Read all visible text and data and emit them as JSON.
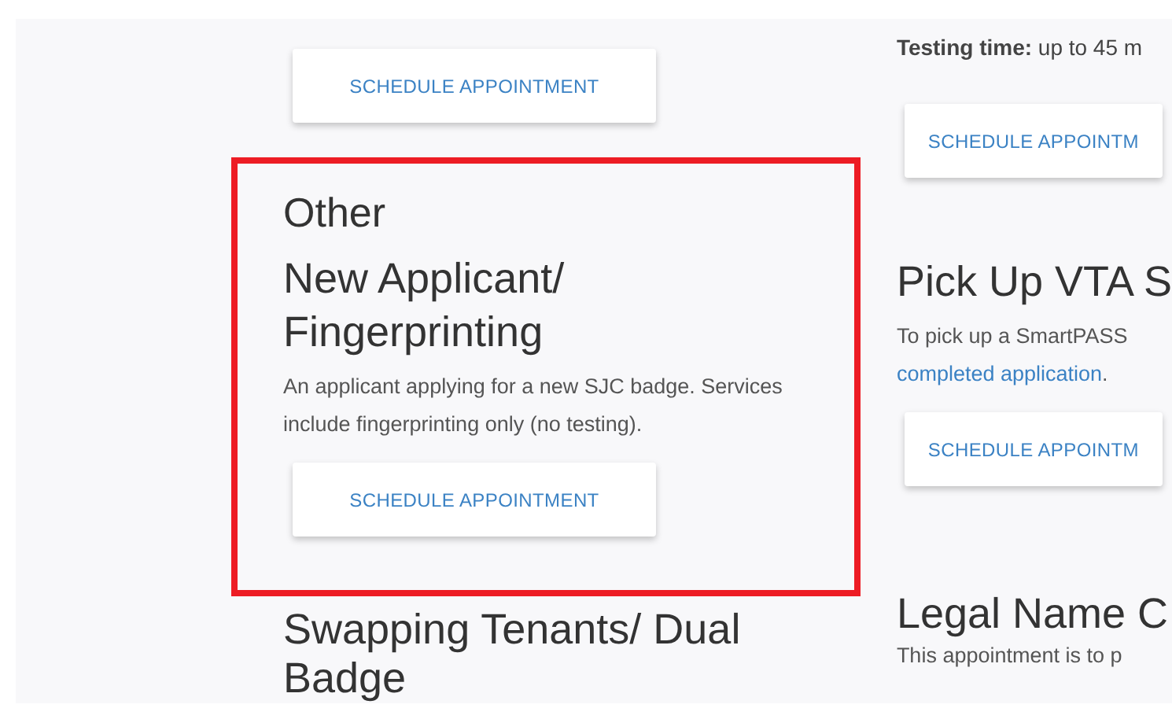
{
  "left_column": {
    "top_button": "SCHEDULE APPOINTMENT",
    "highlighted_card": {
      "category": "Other",
      "title_lines": [
        "New Applicant/",
        "Fingerprinting"
      ],
      "description": "An applicant applying for a new SJC badge. Services include fingerprinting only (no testing).",
      "button": "SCHEDULE APPOINTMENT"
    },
    "next_title_lines": [
      "Swapping Tenants/ Dual",
      "Badge"
    ]
  },
  "right_column": {
    "testing_time": "**Testing time:** up to 45 m",
    "top_button": "SCHEDULE APPOINTM",
    "card": {
      "title": "Pick Up VTA S",
      "description": "To pick up a SmartPASS",
      "link": "completed application",
      "after_link": ".",
      "button": "SCHEDULE APPOINTM"
    },
    "next_title": "Legal Name C",
    "next_description": "This appointment is to p"
  }
}
